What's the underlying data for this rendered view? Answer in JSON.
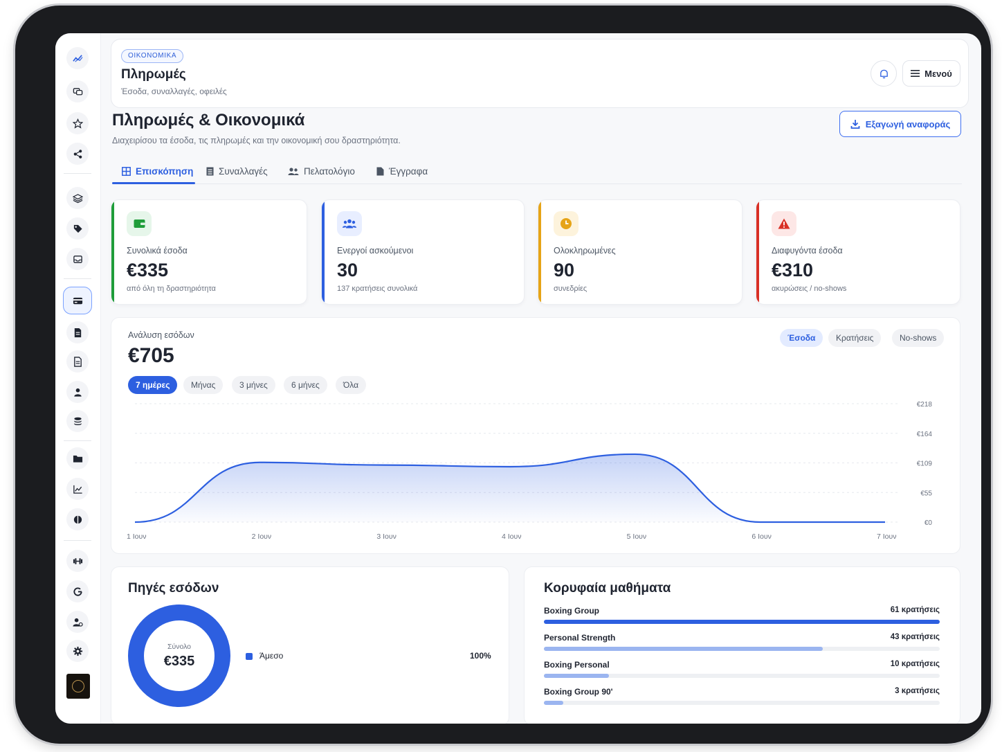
{
  "header": {
    "section_tag": "ΟΙΚΟΝΟΜΙΚΑ",
    "title": "Πληρωμές",
    "subtitle": "Έσοδα, συναλλαγές, οφειλές",
    "menu_label": "Μενού"
  },
  "page": {
    "title": "Πληρωμές & Οικονομικά",
    "subtitle": "Διαχειρίσου τα έσοδα, τις πληρωμές και την οικονομική σου δραστηριότητα.",
    "export_label": "Εξαγωγή αναφοράς"
  },
  "tabs": [
    {
      "label": "Επισκόπηση",
      "icon": "grid-icon",
      "active": true
    },
    {
      "label": "Συναλλαγές",
      "icon": "receipt-icon",
      "active": false
    },
    {
      "label": "Πελατολόγιο",
      "icon": "users-icon",
      "active": false
    },
    {
      "label": "Έγγραφα",
      "icon": "file-icon",
      "active": false
    }
  ],
  "stats": [
    {
      "label": "Συνολικά έσοδα",
      "value": "€335",
      "sub": "από όλη τη δραστηριότητα",
      "icon": "wallet-icon",
      "color": "#1f9d3a"
    },
    {
      "label": "Ενεργοί ασκούμενοι",
      "value": "30",
      "sub": "137 κρατήσεις συνολικά",
      "icon": "users-icon",
      "color": "#2d5fe0"
    },
    {
      "label": "Ολοκληρωμένες",
      "value": "90",
      "sub": "συνεδρίες",
      "icon": "clock-icon",
      "color": "#e6a417"
    },
    {
      "label": "Διαφυγόντα έσοδα",
      "value": "€310",
      "sub": "ακυρώσεις / no-shows",
      "icon": "warning-icon",
      "color": "#d93025"
    }
  ],
  "revenue": {
    "label": "Ανάλυση εσόδων",
    "total": "€705",
    "metric_tabs": [
      "Έσοδα",
      "Κρατήσεις",
      "No-shows"
    ],
    "active_metric": "Έσοδα",
    "range_chips": [
      "7 ημέρες",
      "Μήνας",
      "3 μήνες",
      "6 μήνες",
      "Όλα"
    ],
    "active_range": "7 ημέρες"
  },
  "chart_data": {
    "type": "area",
    "x": [
      "1 Ιουν",
      "2 Ιουν",
      "3 Ιουν",
      "4 Ιουν",
      "5 Ιουν",
      "6 Ιουν",
      "7 Ιουν"
    ],
    "y_ticks": [
      "€218",
      "€164",
      "€109",
      "€55",
      "€0"
    ],
    "ylim": [
      0,
      218
    ],
    "series": [
      {
        "values": [
          0,
          110,
          105,
          102,
          125,
          0,
          0
        ]
      }
    ],
    "color": "#2d5fe0",
    "grid": true
  },
  "sources": {
    "title": "Πηγές εσόδων",
    "total_label": "Σύνολο",
    "total_value": "€335",
    "items": [
      {
        "label": "Άμεσο",
        "percent": "100%",
        "share": 1.0,
        "color": "#2d5fe0"
      }
    ]
  },
  "top_classes": {
    "title": "Κορυφαία μαθήματα",
    "items": [
      {
        "name": "Boxing Group",
        "count_label": "61 κρατήσεις",
        "count": 61,
        "color": "#2d5fe0"
      },
      {
        "name": "Personal Strength",
        "count_label": "43 κρατήσεις",
        "count": 43,
        "color": "#9bb5f0"
      },
      {
        "name": "Boxing Personal",
        "count_label": "10 κρατήσεις",
        "count": 10,
        "color": "#9bb5f0"
      },
      {
        "name": "Boxing Group 90'",
        "count_label": "3 κρατήσεις",
        "count": 3,
        "color": "#9bb5f0"
      }
    ]
  }
}
